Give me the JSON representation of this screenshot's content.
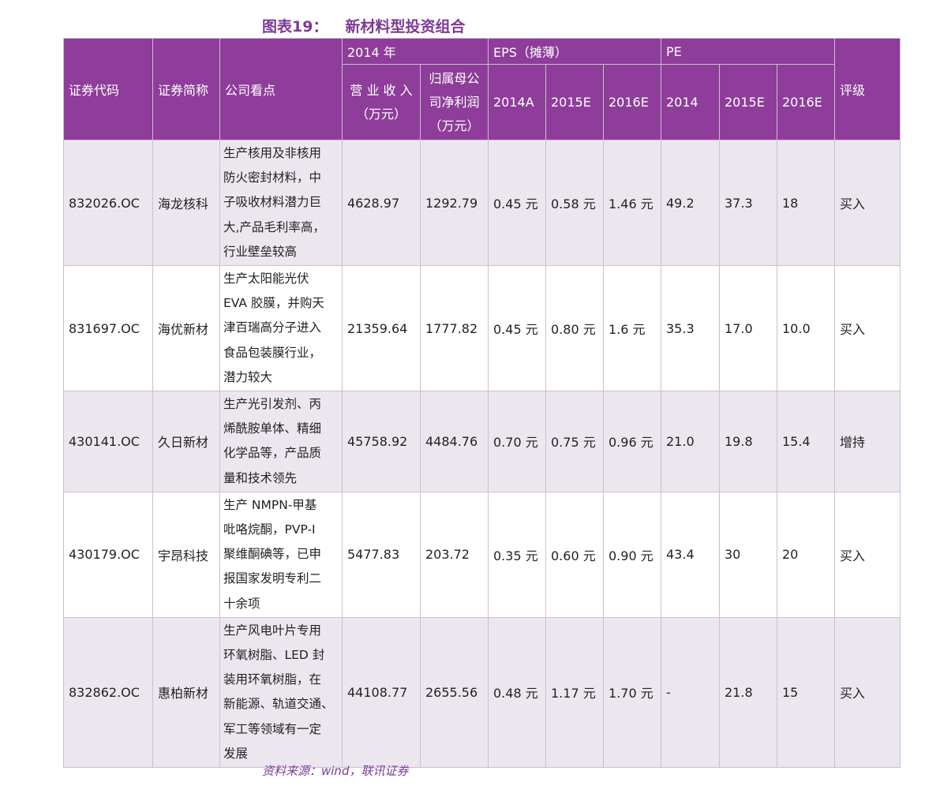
{
  "title": {
    "label": "图表19：",
    "name": "新材料型投资组合"
  },
  "header": {
    "code": "证券代码",
    "short_name": "证券简称",
    "view": "公司看点",
    "year_group": "2014 年",
    "revenue": [
      "营 业 收 入",
      "（万元）"
    ],
    "profit": [
      "归属母公",
      "司净利润",
      "（万元）"
    ],
    "eps_group": "EPS（摊薄）",
    "eps_years": [
      "2014A",
      "2015E",
      "2016E"
    ],
    "pe_group": "PE",
    "pe_years": [
      "2014",
      "2015E",
      "2016E"
    ],
    "rating": "评级"
  },
  "rows": [
    {
      "code": "832026.OC",
      "name": "海龙核科",
      "view": [
        "生产核用及非核用",
        "防火密封材料，中",
        "子吸收材料潜力巨",
        "大,产品毛利率高，",
        "行业壁垒较高"
      ],
      "revenue": "4628.97",
      "profit": "1292.79",
      "eps": [
        "0.45 元",
        "0.58 元",
        "1.46 元"
      ],
      "pe": [
        "49.2",
        "37.3",
        "18"
      ],
      "rating": "买入"
    },
    {
      "code": "831697.OC",
      "name": "海优新材",
      "view": [
        "生产太阳能光伏",
        "EVA 胶膜，并购天",
        "津百瑞高分子进入",
        "食品包装膜行业，",
        "潜力较大"
      ],
      "revenue": "21359.64",
      "profit": "1777.82",
      "eps": [
        "0.45 元",
        "0.80 元",
        "1.6 元"
      ],
      "pe": [
        "35.3",
        "17.0",
        "10.0"
      ],
      "rating": "买入"
    },
    {
      "code": "430141.OC",
      "name": "久日新材",
      "view": [
        "生产光引发剂、丙",
        "烯酰胺单体、精细",
        "化学品等，产品质",
        "量和技术领先"
      ],
      "revenue": "45758.92",
      "profit": "4484.76",
      "eps": [
        "0.70 元",
        "0.75 元",
        "0.96 元"
      ],
      "pe": [
        "21.0",
        "19.8",
        "15.4"
      ],
      "rating": "增持"
    },
    {
      "code": "430179.OC",
      "name": "宇昂科技",
      "view": [
        "生产 NMPN-甲基",
        "吡咯烷酮，PVP-I",
        "聚维酮碘等，已申",
        "报国家发明专利二",
        "十余项"
      ],
      "revenue": "5477.83",
      "profit": "203.72",
      "eps": [
        "0.35 元",
        "0.60 元",
        "0.90 元"
      ],
      "pe": [
        "43.4",
        "30",
        "20"
      ],
      "rating": "买入"
    },
    {
      "code": "832862.OC",
      "name": "惠柏新材",
      "view": [
        "生产风电叶片专用",
        "环氧树脂、LED 封",
        "装用环氧树脂，在",
        "新能源、轨道交通、",
        "军工等领域有一定",
        "发展"
      ],
      "revenue": "44108.77",
      "profit": "2655.56",
      "eps": [
        "0.48 元",
        "1.17 元",
        "1.70 元"
      ],
      "pe": [
        "-",
        "21.8",
        "15"
      ],
      "rating": "买入"
    }
  ],
  "source": "资料来源：wind，联讯证券",
  "colors": {
    "header_bg": "#8e3d9a",
    "title": "#7b3a94",
    "band": "#ece7ef"
  }
}
